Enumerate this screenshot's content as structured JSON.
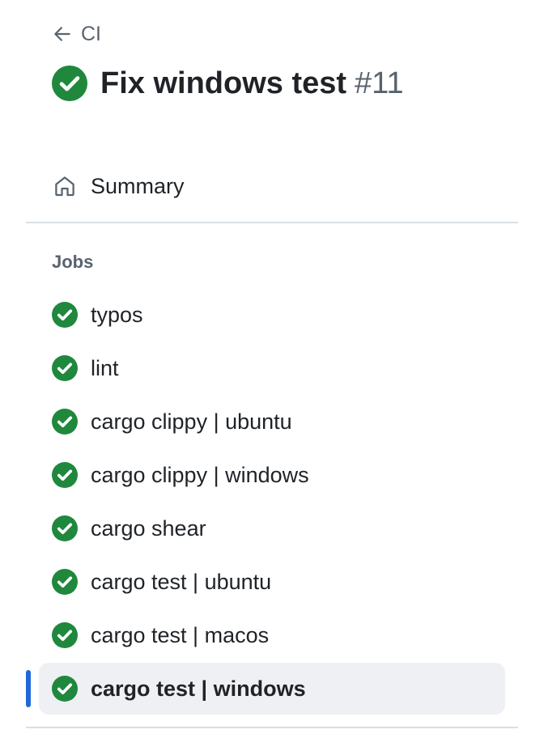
{
  "header": {
    "back_label": "CI",
    "run_title": "Fix windows test",
    "run_number": "#11",
    "status": "success"
  },
  "nav": {
    "summary_label": "Summary"
  },
  "jobs": {
    "heading": "Jobs",
    "items": [
      {
        "label": "typos",
        "status": "success",
        "active": false
      },
      {
        "label": "lint",
        "status": "success",
        "active": false
      },
      {
        "label": "cargo clippy | ubuntu",
        "status": "success",
        "active": false
      },
      {
        "label": "cargo clippy | windows",
        "status": "success",
        "active": false
      },
      {
        "label": "cargo shear",
        "status": "success",
        "active": false
      },
      {
        "label": "cargo test | ubuntu",
        "status": "success",
        "active": false
      },
      {
        "label": "cargo test | macos",
        "status": "success",
        "active": false
      },
      {
        "label": "cargo test | windows",
        "status": "success",
        "active": true
      }
    ]
  },
  "colors": {
    "success": "#1f883d",
    "accent": "#2068d7",
    "active_bg": "#eef0f3",
    "muted_text": "#59636e",
    "text": "#1f2328",
    "divider": "#d8dee4"
  },
  "icons": {
    "back": "arrow-left-icon",
    "status": "check-circle-fill-icon",
    "summary": "home-icon"
  }
}
